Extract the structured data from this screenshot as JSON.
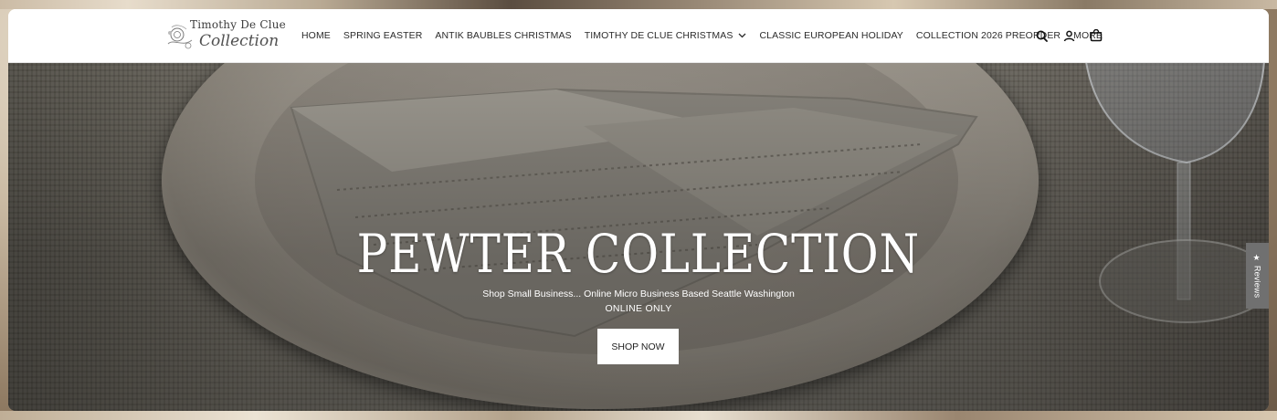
{
  "brand": {
    "logo_line1": "Timothy De Clue",
    "logo_line2": "Collection"
  },
  "nav": {
    "items": [
      {
        "label": "HOME"
      },
      {
        "label": "SPRING EASTER"
      },
      {
        "label": "ANTIK BAUBLES CHRISTMAS"
      },
      {
        "label": "TIMOTHY DE CLUE CHRISTMAS",
        "has_dropdown": true
      },
      {
        "label": "CLASSIC EUROPEAN HOLIDAY"
      },
      {
        "label": "COLLECTION 2026 PREORDER"
      },
      {
        "label": "MORE"
      }
    ]
  },
  "header_icons": [
    "search-icon",
    "account-icon",
    "cart-icon"
  ],
  "hero": {
    "title": "PEWTER COLLECTION",
    "subtitle": "Shop Small Business... Online Micro Business Based Seattle Washington",
    "subtitle2": "ONLINE ONLY",
    "cta_label": "SHOP NOW"
  },
  "reviews_tab": {
    "label": "★ Reviews"
  },
  "colors": {
    "header_bg": "#ffffff",
    "nav_text": "#2b2b2b",
    "hero_text": "#ffffff",
    "button_bg": "#ffffff",
    "reviews_tab_bg": "#707070"
  }
}
